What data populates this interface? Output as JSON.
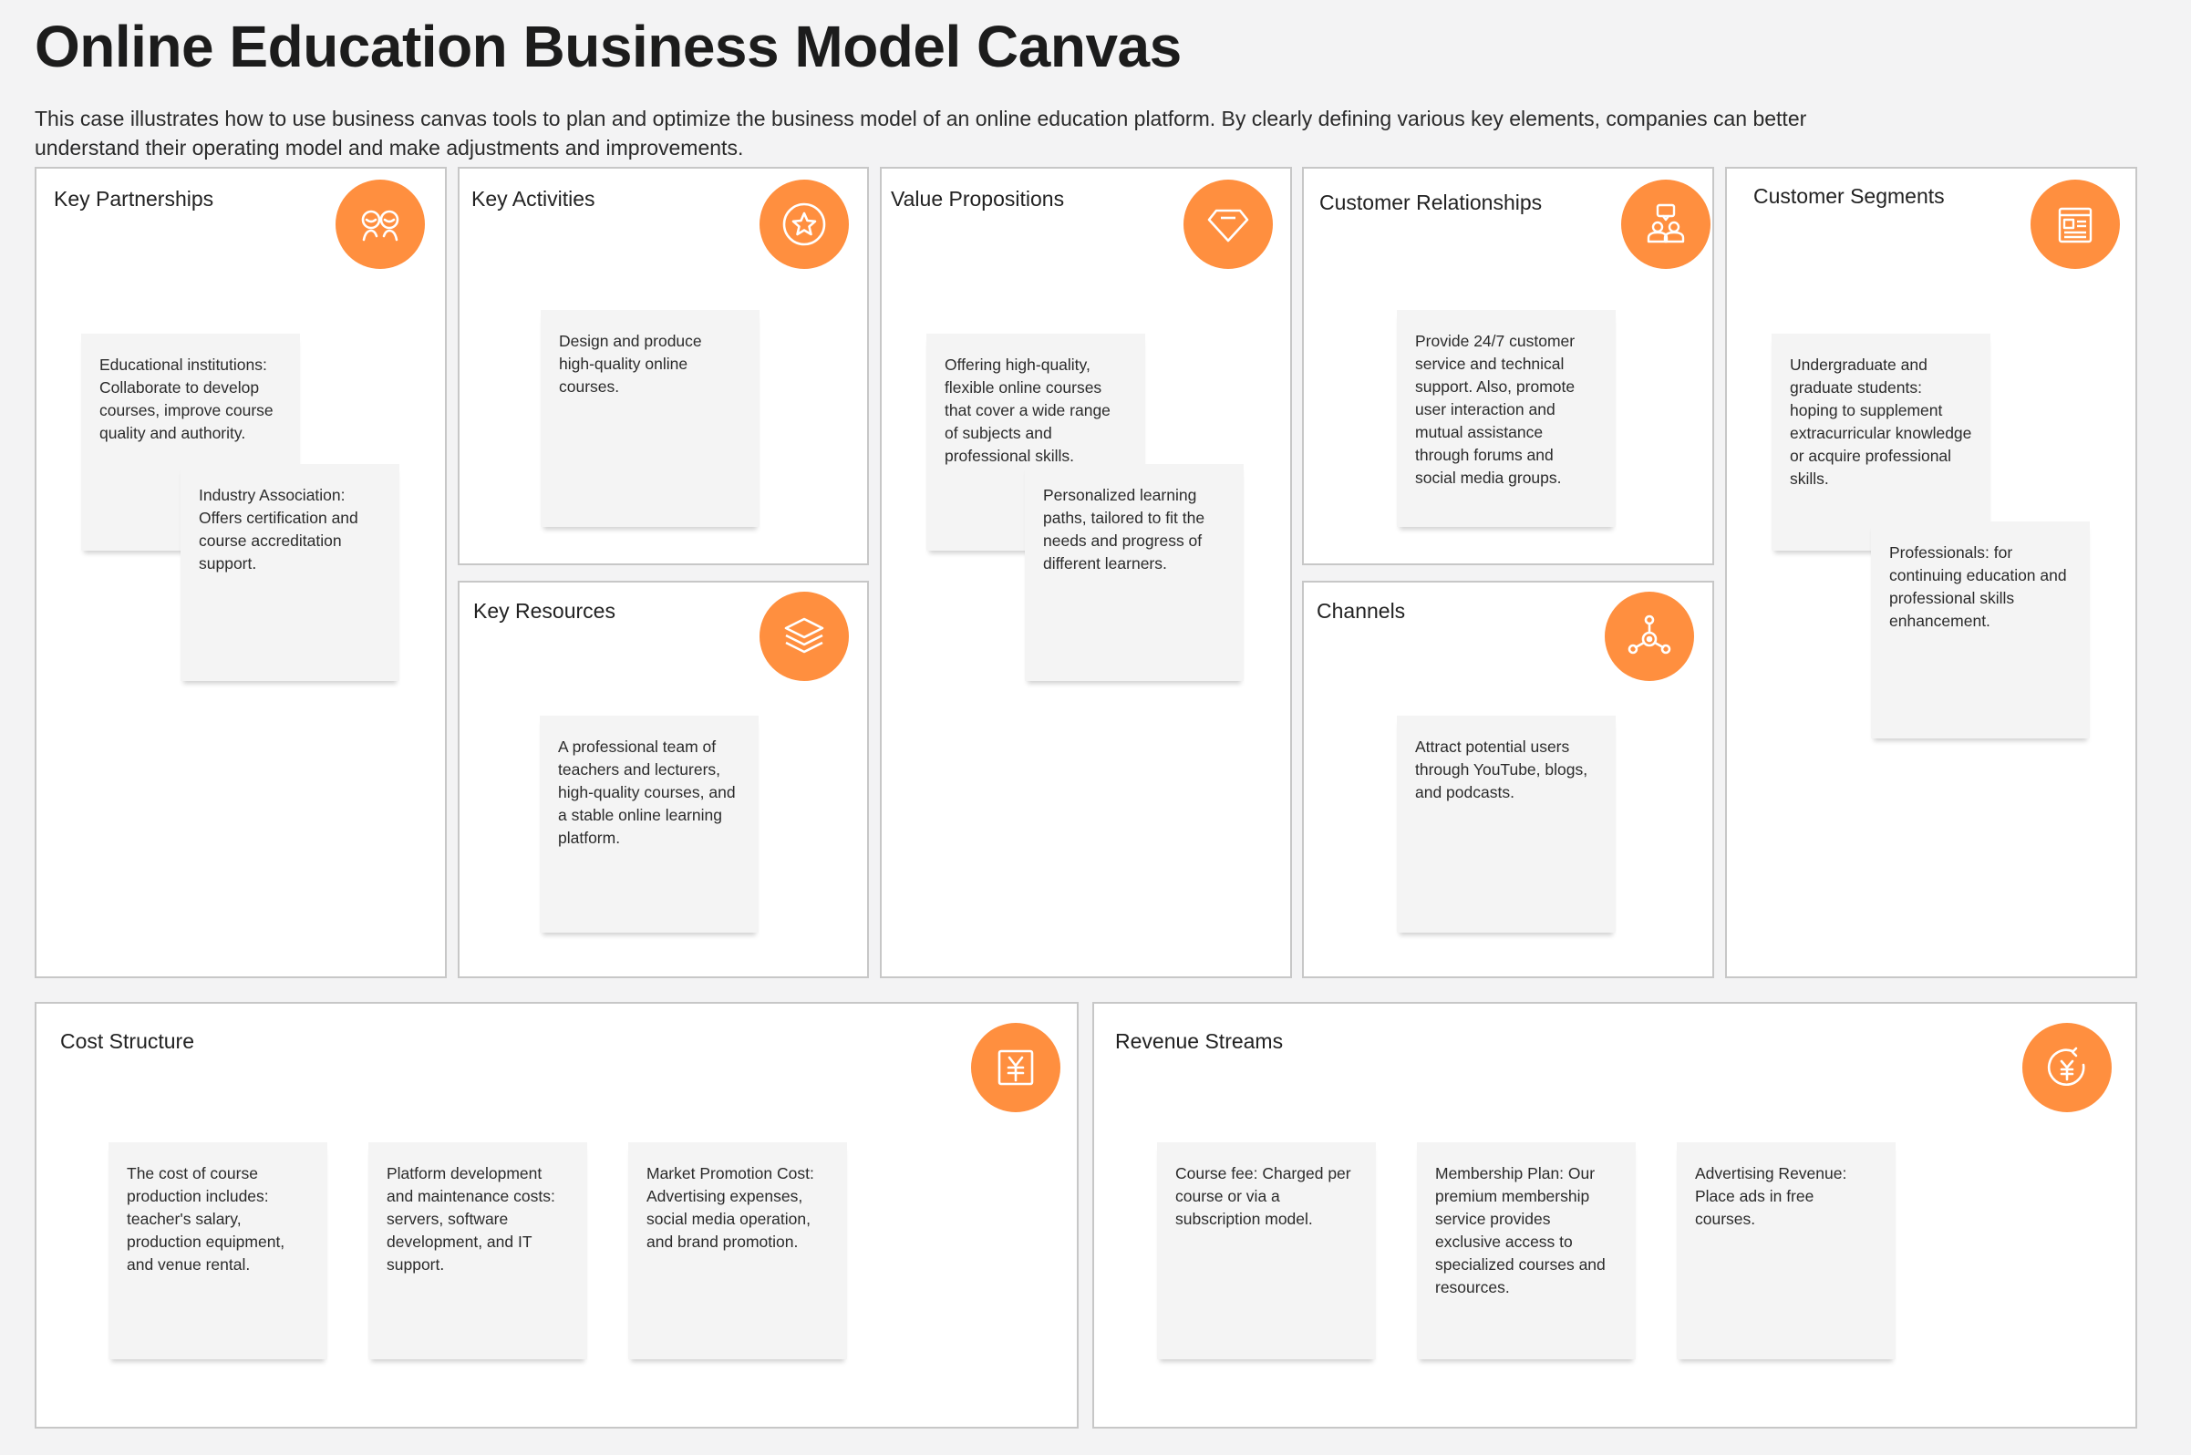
{
  "header": {
    "title": "Online Education Business Model Canvas",
    "description": "This case illustrates how to use business canvas tools to plan and optimize the business model of an online education platform. By clearly defining various key elements, companies can better understand their operating model and make adjustments and improvements."
  },
  "theme": {
    "accent": "#ff8f3f",
    "border": "#c7c7c7",
    "note_bg": "#f4f4f4"
  },
  "blocks": {
    "key_partnerships": {
      "title": "Key Partnerships",
      "icon": "people-icon",
      "notes": [
        "Educational institutions: Collaborate to develop courses, improve course quality and authority.",
        "Industry Association: Offers certification and course accreditation support."
      ]
    },
    "key_activities": {
      "title": "Key Activities",
      "icon": "star-circle-icon",
      "notes": [
        "Design and produce high-quality online courses."
      ]
    },
    "key_resources": {
      "title": "Key Resources",
      "icon": "layers-icon",
      "notes": [
        "A professional team of teachers and lecturers, high-quality courses, and a stable online learning platform."
      ]
    },
    "value_propositions": {
      "title": "Value Propositions",
      "icon": "diamond-icon",
      "notes": [
        "Offering high-quality, flexible online courses that cover a wide range of subjects and professional skills.",
        "Personalized learning paths, tailored to fit the needs and progress of different learners."
      ]
    },
    "customer_relationships": {
      "title": "Customer Relationships",
      "icon": "users-chat-icon",
      "notes": [
        "Provide 24/7 customer service and technical support. Also, promote user interaction and mutual assistance through forums and social media groups."
      ]
    },
    "channels": {
      "title": "Channels",
      "icon": "network-icon",
      "notes": [
        "Attract potential users through YouTube, blogs, and podcasts."
      ]
    },
    "customer_segments": {
      "title": "Customer Segments",
      "icon": "id-card-icon",
      "notes": [
        "Undergraduate and graduate students: hoping to supplement extracurricular knowledge or acquire professional skills.",
        "Professionals: for continuing education and professional skills enhancement."
      ]
    },
    "cost_structure": {
      "title": "Cost Structure",
      "icon": "yen-box-icon",
      "notes": [
        "The cost of course production includes: teacher's salary, production equipment, and venue rental.",
        "Platform development and maintenance costs: servers, software development, and IT support.",
        "Market Promotion Cost: Advertising expenses, social media operation, and brand promotion."
      ]
    },
    "revenue_streams": {
      "title": "Revenue Streams",
      "icon": "yen-return-icon",
      "notes": [
        "Course fee: Charged per course or via a subscription model.",
        "Membership Plan: Our premium membership service provides exclusive access to specialized courses and resources.",
        "Advertising Revenue: Place ads in free courses."
      ]
    }
  }
}
